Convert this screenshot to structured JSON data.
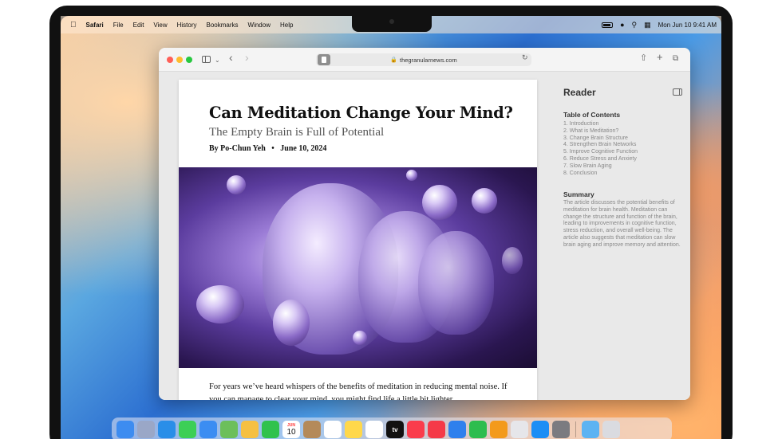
{
  "menubar": {
    "apple_icon": "apple-icon",
    "items": [
      "Safari",
      "File",
      "Edit",
      "View",
      "History",
      "Bookmarks",
      "Window",
      "Help"
    ],
    "status": {
      "date_time": "Mon Jun 10  9:41 AM"
    }
  },
  "browser": {
    "url": "thegranularnews.com"
  },
  "article": {
    "title": "Can Meditation Change Your Mind?",
    "subtitle": "The Empty Brain is Full of Potential",
    "author": "By Po-Chun Yeh",
    "separator": "•",
    "date": "June 10, 2024",
    "body": "For years we’ve heard whispers of the benefits of meditation in reducing mental noise. If you can manage to clear your mind, you might find life a little bit lighter."
  },
  "reader": {
    "title": "Reader",
    "toc_heading": "Table of Contents",
    "toc": [
      "1.  Introduction",
      "2.  What is Meditation?",
      "3.  Change Brain Structure",
      "4.  Strengthen Brain Networks",
      "5.  Improve Cognitive Function",
      "6.  Reduce Stress and Anxiety",
      "7.  Slow Brain Aging",
      "8.  Conclusion"
    ],
    "summary_heading": "Summary",
    "summary": "The article discusses the potential benefits of meditation for brain health. Meditation can change the structure and function of the brain, leading to improvements in cognitive function, stress reduction, and overall well-being. The article also suggests that meditation can slow brain aging and improve memory and attention."
  },
  "dock": {
    "calendar_month": "JUN",
    "calendar_day": "10",
    "tv_label": "tv",
    "apps": [
      {
        "name": "finder-icon",
        "color": "#3d8cf0"
      },
      {
        "name": "launchpad-icon",
        "color": "#9aa7c7"
      },
      {
        "name": "safari-icon",
        "color": "#2a8ee8"
      },
      {
        "name": "messages-icon",
        "color": "#3ccf56"
      },
      {
        "name": "mail-icon",
        "color": "#3b8df2"
      },
      {
        "name": "maps-icon",
        "color": "#6cbf5b"
      },
      {
        "name": "photos-icon",
        "color": "#f5c042"
      },
      {
        "name": "facetime-icon",
        "color": "#30c24d"
      },
      {
        "name": "calendar-icon",
        "color": "#ffffff"
      },
      {
        "name": "contacts-icon",
        "color": "#b48a5a"
      },
      {
        "name": "reminders-icon",
        "color": "#ffffff"
      },
      {
        "name": "notes-icon",
        "color": "#ffd84a"
      },
      {
        "name": "freeform-icon",
        "color": "#ffffff"
      },
      {
        "name": "tv-icon",
        "color": "#111111"
      },
      {
        "name": "music-icon",
        "color": "#fa3c4c"
      },
      {
        "name": "news-icon",
        "color": "#f53a48"
      },
      {
        "name": "keynote-icon",
        "color": "#2f80ed"
      },
      {
        "name": "numbers-icon",
        "color": "#2ebd4e"
      },
      {
        "name": "pages-icon",
        "color": "#f39a1c"
      },
      {
        "name": "iphone-mirroring-icon",
        "color": "#e6e6ea"
      },
      {
        "name": "app-store-icon",
        "color": "#1c8ef5"
      },
      {
        "name": "system-settings-icon",
        "color": "#7b7b80"
      },
      {
        "name": "downloads-folder-icon",
        "color": "#5cb3f2"
      },
      {
        "name": "trash-icon",
        "color": "#dadbe0"
      }
    ]
  }
}
